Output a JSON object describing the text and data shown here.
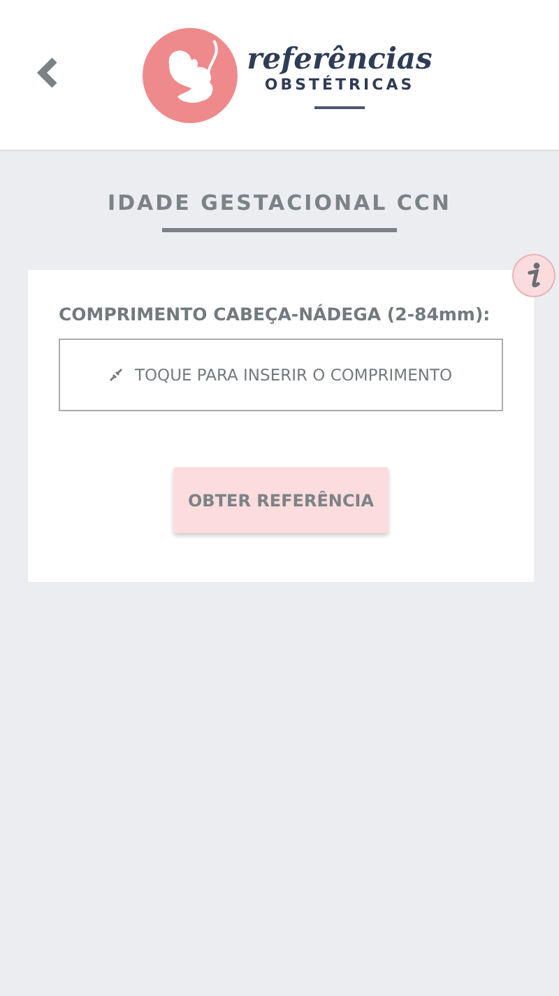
{
  "header": {
    "logo_title": "referências",
    "logo_subtitle": "OBSTÉTRICAS"
  },
  "page_title": "IDADE GESTACIONAL CCN",
  "form": {
    "label": "COMPRIMENTO CABEÇA-NÁDEGA (2-84mm):",
    "field": {
      "placeholder": "TOQUE PARA INSERIR O COMPRIMENTO"
    },
    "button": "OBTER REFERÊNCIA"
  }
}
